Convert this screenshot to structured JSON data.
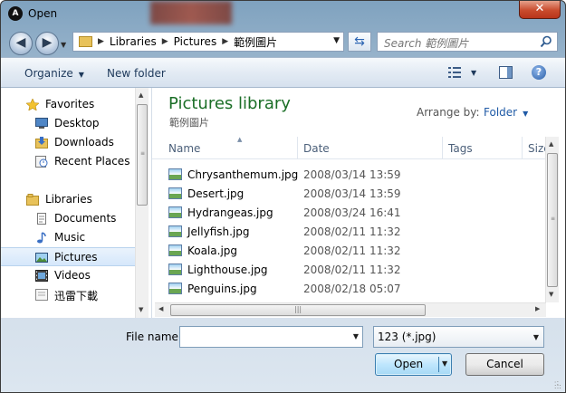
{
  "window": {
    "title": "Open",
    "close_label": "✕"
  },
  "address_bar": {
    "crumbs": [
      "Libraries",
      "Pictures",
      "範例圖片"
    ],
    "search_placeholder": "Search 範例圖片"
  },
  "toolbar": {
    "organize": "Organize",
    "new_folder": "New folder"
  },
  "nav_pane": {
    "favorites": {
      "header": "Favorites",
      "items": [
        "Desktop",
        "Downloads",
        "Recent Places"
      ]
    },
    "libraries": {
      "header": "Libraries",
      "items": [
        "Documents",
        "Music",
        "Pictures",
        "Videos",
        "迅雷下載"
      ],
      "selected": "Pictures"
    }
  },
  "content": {
    "title": "Pictures library",
    "subtitle": "範例圖片",
    "arrange_label": "Arrange by:",
    "arrange_value": "Folder",
    "columns": [
      "Name",
      "Date",
      "Tags",
      "Size"
    ],
    "files": [
      {
        "name": "Chrysanthemum.jpg",
        "date": "2008/03/14 13:59"
      },
      {
        "name": "Desert.jpg",
        "date": "2008/03/14 13:59"
      },
      {
        "name": "Hydrangeas.jpg",
        "date": "2008/03/24 16:41"
      },
      {
        "name": "Jellyfish.jpg",
        "date": "2008/02/11 11:32"
      },
      {
        "name": "Koala.jpg",
        "date": "2008/02/11 11:32"
      },
      {
        "name": "Lighthouse.jpg",
        "date": "2008/02/11 11:32"
      },
      {
        "name": "Penguins.jpg",
        "date": "2008/02/18 05:07"
      }
    ]
  },
  "bottom": {
    "file_name_label": "File name:",
    "file_name_value": "",
    "filter_value": "123 (*.jpg)",
    "open_label": "Open",
    "cancel_label": "Cancel"
  },
  "icons": {
    "app": "app-logo-icon",
    "back": "back-arrow-icon",
    "forward": "forward-arrow-icon",
    "refresh": "refresh-icon",
    "search": "search-icon",
    "help": "help-icon"
  },
  "colors": {
    "library_title": "#1a6e26",
    "close_button": "#c94b2d",
    "selection": "#d5e7fb"
  }
}
